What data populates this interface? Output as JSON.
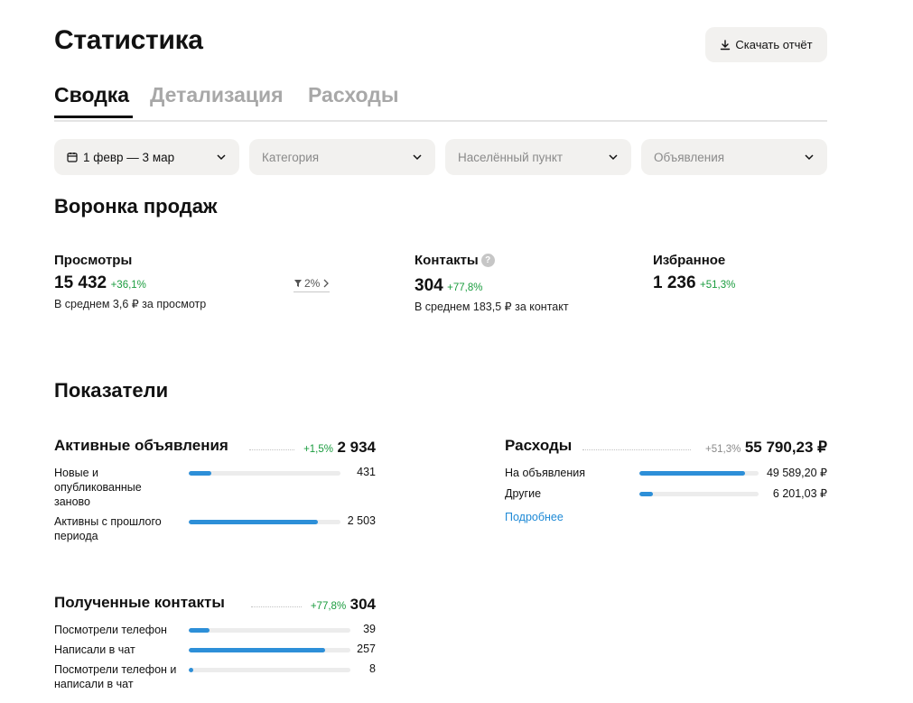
{
  "header": {
    "title": "Статистика",
    "download_label": "Скачать отчёт",
    "download_icon": "download-icon"
  },
  "tabs": [
    {
      "label": "Сводка",
      "active": true
    },
    {
      "label": "Детализация",
      "active": false
    },
    {
      "label": "Расходы",
      "active": false
    }
  ],
  "filters": {
    "date": {
      "value": "1 февр — 3 мар",
      "icon": "calendar-icon"
    },
    "category": {
      "placeholder": "Категория"
    },
    "location": {
      "placeholder": "Населённый пункт"
    },
    "ads": {
      "placeholder": "Объявления"
    }
  },
  "funnel": {
    "title": "Воронка продаж",
    "views": {
      "label": "Просмотры",
      "value": "15 432",
      "delta": "+36,1%",
      "sub": "В среднем 3,6 ₽ за просмотр"
    },
    "conversion": {
      "value": "2%",
      "icon": "funnel-icon"
    },
    "contacts": {
      "label": "Контакты",
      "help": "?",
      "value": "304",
      "delta": "+77,8%",
      "sub": "В среднем 183,5 ₽ за контакт"
    },
    "favorites": {
      "label": "Избранное",
      "value": "1 236",
      "delta": "+51,3%"
    }
  },
  "indicators": {
    "title": "Показатели",
    "active_ads": {
      "title": "Активные объявления",
      "delta": "+1,5%",
      "total": "2 934",
      "rows": [
        {
          "label": "Новые и опубликованные заново",
          "value": "431",
          "fraction": 0.147
        },
        {
          "label": "Активны с прошлого периода",
          "value": "2 503",
          "fraction": 0.853
        }
      ]
    },
    "expenses": {
      "title": "Расходы",
      "delta": "+51,3%",
      "total": "55 790,23 ₽",
      "rows": [
        {
          "label": "На объявления",
          "value": "49 589,20 ₽",
          "fraction": 0.889
        },
        {
          "label": "Другие",
          "value": "6 201,03 ₽",
          "fraction": 0.111
        }
      ],
      "more_link": "Подробнее"
    },
    "contacts": {
      "title": "Полученные контакты",
      "delta": "+77,8%",
      "total": "304",
      "rows": [
        {
          "label": "Посмотрели телефон",
          "value": "39",
          "fraction": 0.128
        },
        {
          "label": "Написали в чат",
          "value": "257",
          "fraction": 0.845
        },
        {
          "label": "Посмотрели телефон и написали в чат",
          "value": "8",
          "fraction": 0.026
        }
      ]
    }
  },
  "colors": {
    "accent": "#2d8fd8",
    "positive": "#1a9c3e",
    "chip_bg": "#f2f1ef"
  }
}
